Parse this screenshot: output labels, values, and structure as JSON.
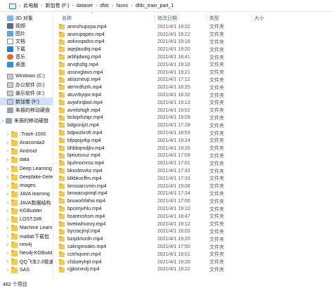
{
  "address": {
    "crumbs": [
      "此电脑",
      "新加卷 (F:)",
      "dataset",
      "dfdc",
      "faces",
      "dfdc_train_part_1"
    ]
  },
  "columns": {
    "name": "名称",
    "date": "修改日期",
    "type": "类型",
    "size": "大小"
  },
  "nav": [
    {
      "label": "3D 对象",
      "icon": "cube-icon"
    },
    {
      "label": "视频",
      "icon": "video-icon"
    },
    {
      "label": "图片",
      "icon": "picture-icon"
    },
    {
      "label": "文档",
      "icon": "document-icon"
    },
    {
      "label": "下载",
      "icon": "download-icon"
    },
    {
      "label": "音乐",
      "icon": "music-icon"
    },
    {
      "label": "桌面",
      "icon": "desktop-icon"
    },
    {
      "label": "Windows (C:)",
      "icon": "drive-icon"
    },
    {
      "label": "办公软件 (D:)",
      "icon": "drive-icon"
    },
    {
      "label": "娱乐软件 (E:)",
      "icon": "drive-icon"
    },
    {
      "label": "新加卷 (F:)",
      "icon": "drive-icon"
    },
    {
      "label": "朱振的移动硬盘",
      "icon": "usb-drive-icon"
    },
    {
      "label": "朱振的移动硬盘",
      "icon": "usb-drive-icon"
    },
    {
      "label": ".Trash-1000",
      "icon": "folder-icon"
    },
    {
      "label": "Anaconda3",
      "icon": "folder-icon"
    },
    {
      "label": "Android",
      "icon": "folder-icon"
    },
    {
      "label": "data",
      "icon": "folder-icon"
    },
    {
      "label": "Deep Learning",
      "icon": "folder-icon"
    },
    {
      "label": "Deepfake-Dete",
      "icon": "folder-icon"
    },
    {
      "label": "images",
      "icon": "folder-icon"
    },
    {
      "label": "JAVA learning",
      "icon": "folder-icon"
    },
    {
      "label": "JAVA数据结构",
      "icon": "folder-icon"
    },
    {
      "label": "KGBuilder",
      "icon": "folder-icon"
    },
    {
      "label": "LOST.DIR",
      "icon": "folder-icon"
    },
    {
      "label": "Machine Learn",
      "icon": "folder-icon"
    },
    {
      "label": "matlab下载包",
      "icon": "folder-icon"
    },
    {
      "label": "neo4j",
      "icon": "folder-icon"
    },
    {
      "label": "Neo4j-KGBuild",
      "icon": "folder-icon"
    },
    {
      "label": "QQ飞车2.0极速",
      "icon": "folder-icon"
    },
    {
      "label": "SAS",
      "icon": "folder-icon"
    }
  ],
  "files": [
    {
      "name": "anmzhupzpa.mp4",
      "date": "2021/4/1 19:22",
      "type": "文件夹"
    },
    {
      "name": "anorupqpeo.mp4",
      "date": "2021/4/1 19:22",
      "type": "文件夹"
    },
    {
      "name": "aokxvqadsx.mp4",
      "date": "2021/4/1 19:16",
      "type": "文件夹"
    },
    {
      "name": "aqejlaudtq.mp4",
      "date": "2021/4/1 19:20",
      "type": "文件夹"
    },
    {
      "name": "arbhjdwxg.mp4",
      "date": "2021/4/1 18:41",
      "type": "文件夹"
    },
    {
      "name": "arvqhzltg.mp4",
      "date": "2021/4/1 19:10",
      "type": "文件夹"
    },
    {
      "name": "assnxglavo.mp4",
      "date": "2021/4/1 19:21",
      "type": "文件夹"
    },
    {
      "name": "atisizneup.mp4",
      "date": "2021/4/1 17:12",
      "type": "文件夹"
    },
    {
      "name": "atrmrdhzrk.mp4",
      "date": "2021/4/1 18:25",
      "type": "文件夹"
    },
    {
      "name": "atuvrbyqor.mp4",
      "date": "2021/4/1 18:32",
      "type": "文件夹"
    },
    {
      "name": "avjwhrqbwl.mp4",
      "date": "2021/4/1 19:13",
      "type": "文件夹"
    },
    {
      "name": "avmlshqjh.mp4",
      "date": "2021/4/1 19:02",
      "type": "文件夹"
    },
    {
      "name": "bcbqxhziqz.mp4",
      "date": "2021/4/1 19:09",
      "type": "文件夹"
    },
    {
      "name": "bdgcinijzt.mp4",
      "date": "2021/4/1 17:28",
      "type": "文件夹"
    },
    {
      "name": "bdpwzkrofr.mp4",
      "date": "2021/4/1 18:53",
      "type": "文件夹"
    },
    {
      "name": "bfpqojyrkp.mp4",
      "date": "2021/4/1 19:24",
      "type": "文件夹"
    },
    {
      "name": "bhbbqmdjkv.mp4",
      "date": "2021/4/1 19:26",
      "type": "文件夹"
    },
    {
      "name": "bjeiutsvuz.mp4",
      "date": "2021/4/1 17:09",
      "type": "文件夹"
    },
    {
      "name": "bjuhnomrsu.mp4",
      "date": "2021/4/1 17:01",
      "type": "文件夹"
    },
    {
      "name": "bkxxbtsvkz.mp4",
      "date": "2021/4/1 17:33",
      "type": "文件夹"
    },
    {
      "name": "blkbkvcffm.mp4",
      "date": "2021/4/1 17:33",
      "type": "文件夹"
    },
    {
      "name": "bmsoarcvmn.mp4",
      "date": "2021/4/1 19:08",
      "type": "文件夹"
    },
    {
      "name": "bmwacvpmqf.mp4",
      "date": "2021/4/1 17:34",
      "type": "文件夹"
    },
    {
      "name": "bnuwxhfahw.mp4",
      "date": "2021/4/1 17:00",
      "type": "文件夹"
    },
    {
      "name": "bpcimjvhlu.mp4",
      "date": "2021/4/1 19:10",
      "type": "文件夹"
    },
    {
      "name": "bsarexshsm.mp4",
      "date": "2021/4/1 18:47",
      "type": "文件夹"
    },
    {
      "name": "bvekwhumry.mp4",
      "date": "2021/4/1 19:12",
      "type": "文件夹"
    },
    {
      "name": "byrzacjmjl.mp4",
      "date": "2021/4/1 18:03",
      "type": "文件夹"
    },
    {
      "name": "bzqzktvzdn.mp4",
      "date": "2021/4/1 19:20",
      "type": "文件夹"
    },
    {
      "name": "cakngmoakn.mp4",
      "date": "2021/4/1 17:50",
      "type": "文件夹"
    },
    {
      "name": "cctrhqvein.mp4",
      "date": "2021/4/1 19:01",
      "type": "文件夹"
    },
    {
      "name": "cfsbzeyhpl.mp4",
      "date": "2021/4/1 19:20",
      "type": "文件夹"
    },
    {
      "name": "cgkorxrolj.mp4",
      "date": "2021/4/1 19:22",
      "type": "文件夹"
    }
  ],
  "status": {
    "count": "482 个项目"
  }
}
